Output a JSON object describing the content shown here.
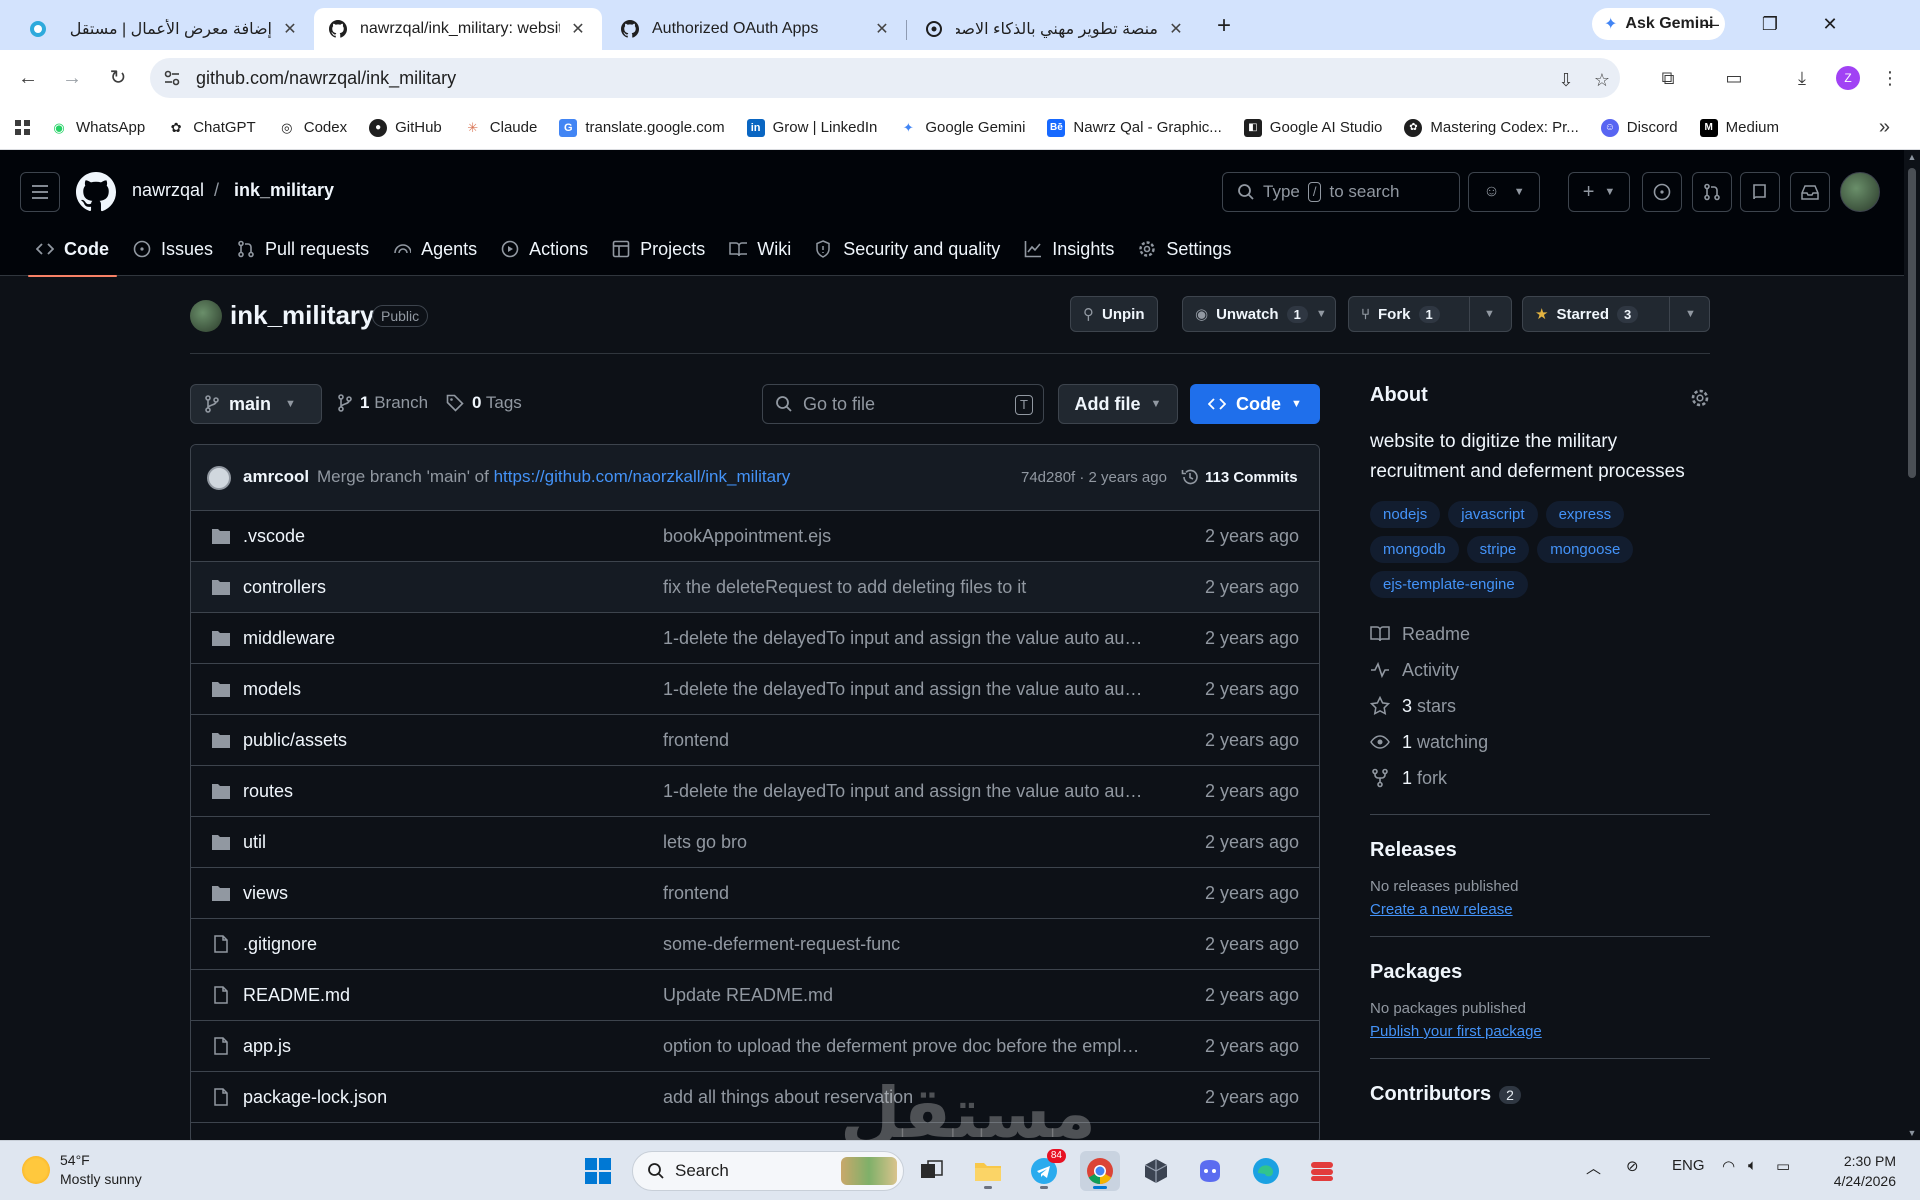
{
  "browser": {
    "tabs": [
      {
        "title": "إضافة معرض الأعمال | مستقل",
        "active": false
      },
      {
        "title": "nawrzqal/ink_military: website t",
        "active": true
      },
      {
        "title": "Authorized OAuth Apps",
        "active": false
      },
      {
        "title": "منصة تطوير مهني بالذكاء الاصط",
        "active": false
      }
    ],
    "ask_gemini": "Ask Gemini",
    "url": "github.com/nawrzqal/ink_military",
    "profile_initial": "Z",
    "bookmarks": [
      {
        "label": "WhatsApp",
        "icon": "whatsapp-icon"
      },
      {
        "label": "ChatGPT",
        "icon": "chatgpt-icon"
      },
      {
        "label": "Codex",
        "icon": "codex-icon"
      },
      {
        "label": "GitHub",
        "icon": "github-icon"
      },
      {
        "label": "Claude",
        "icon": "claude-icon"
      },
      {
        "label": "translate.google.com",
        "icon": "translate-icon"
      },
      {
        "label": "Grow | LinkedIn",
        "icon": "linkedin-icon"
      },
      {
        "label": "Google Gemini",
        "icon": "gemini-icon"
      },
      {
        "label": "Nawrz Qal - Graphic...",
        "icon": "behance-icon"
      },
      {
        "label": "Google AI Studio",
        "icon": "ai-studio-icon"
      },
      {
        "label": "Mastering Codex: Pr...",
        "icon": "openai-icon"
      },
      {
        "label": "Discord",
        "icon": "discord-icon"
      },
      {
        "label": "Medium",
        "icon": "medium-icon"
      }
    ]
  },
  "github": {
    "owner": "nawrzqal",
    "repo": "ink_military",
    "search_placeholder_1": "Type",
    "search_key": "/",
    "search_placeholder_2": "to search",
    "nav": [
      {
        "label": "Code",
        "icon": "code-icon"
      },
      {
        "label": "Issues",
        "icon": "issue-icon"
      },
      {
        "label": "Pull requests",
        "icon": "pull-request-icon"
      },
      {
        "label": "Agents",
        "icon": "agents-icon"
      },
      {
        "label": "Actions",
        "icon": "play-icon"
      },
      {
        "label": "Projects",
        "icon": "table-icon"
      },
      {
        "label": "Wiki",
        "icon": "book-icon"
      },
      {
        "label": "Security and quality",
        "icon": "shield-icon"
      },
      {
        "label": "Insights",
        "icon": "graph-icon"
      },
      {
        "label": "Settings",
        "icon": "gear-icon"
      }
    ],
    "visibility": "Public",
    "actions": {
      "unpin": "Unpin",
      "unwatch": "Unwatch",
      "unwatch_count": "1",
      "fork": "Fork",
      "fork_count": "1",
      "starred": "Starred",
      "star_count": "3"
    },
    "branch": "main",
    "branch_count": "1",
    "branch_label": "Branch",
    "tag_count": "0",
    "tag_label": "Tags",
    "goto_placeholder": "Go to file",
    "goto_key": "T",
    "add_file": "Add file",
    "code_btn": "Code",
    "last_commit": {
      "author": "amrcool",
      "message_prefix": "Merge branch 'main' of",
      "message_link": "https://github.com/naorzkall/ink_military",
      "hash_time": "74d280f · 2 years ago",
      "commits": "113 Commits"
    },
    "files": [
      {
        "name": ".vscode",
        "type": "dir",
        "message": "bookAppointment.ejs",
        "time": "2 years ago"
      },
      {
        "name": "controllers",
        "type": "dir",
        "message": "fix the deleteRequest to add deleting files to it",
        "time": "2 years ago"
      },
      {
        "name": "middleware",
        "type": "dir",
        "message": "1-delete the delayedTo input and assign the value auto auto...",
        "time": "2 years ago"
      },
      {
        "name": "models",
        "type": "dir",
        "message": "1-delete the delayedTo input and assign the value auto auto...",
        "time": "2 years ago"
      },
      {
        "name": "public/assets",
        "type": "dir",
        "message": "frontend",
        "time": "2 years ago"
      },
      {
        "name": "routes",
        "type": "dir",
        "message": "1-delete the delayedTo input and assign the value auto auto...",
        "time": "2 years ago"
      },
      {
        "name": "util",
        "type": "dir",
        "message": "lets go bro",
        "time": "2 years ago"
      },
      {
        "name": "views",
        "type": "dir",
        "message": "frontend",
        "time": "2 years ago"
      },
      {
        "name": ".gitignore",
        "type": "file",
        "message": "some-deferment-request-func",
        "time": "2 years ago"
      },
      {
        "name": "README.md",
        "type": "file",
        "message": "Update README.md",
        "time": "2 years ago"
      },
      {
        "name": "app.js",
        "type": "file",
        "message": "option to upload the deferment prove doc before the emplo...",
        "time": "2 years ago"
      },
      {
        "name": "package-lock.json",
        "type": "file",
        "message": "add all things about reservation",
        "time": "2 years ago"
      }
    ],
    "about": {
      "title": "About",
      "description": "website to digitize the military recruitment and deferment processes",
      "topics": [
        "nodejs",
        "javascript",
        "express",
        "mongodb",
        "stripe",
        "mongoose",
        "ejs-template-engine"
      ],
      "readme": "Readme",
      "activity": "Activity",
      "stars_num": "3",
      "stars_label": "stars",
      "watching_num": "1",
      "watching_label": "watching",
      "fork_num": "1",
      "fork_label": "fork"
    },
    "releases": {
      "title": "Releases",
      "empty": "No releases published",
      "link": "Create a new release"
    },
    "packages": {
      "title": "Packages",
      "empty": "No packages published",
      "link": "Publish your first package"
    },
    "contributors": {
      "title": "Contributors",
      "count": "2"
    }
  },
  "watermark": "مستقل",
  "taskbar": {
    "temp": "54°F",
    "weather": "Mostly sunny",
    "search": "Search",
    "lang": "ENG",
    "time": "2:30 PM",
    "date": "4/24/2026",
    "telegram_badge": "84"
  }
}
